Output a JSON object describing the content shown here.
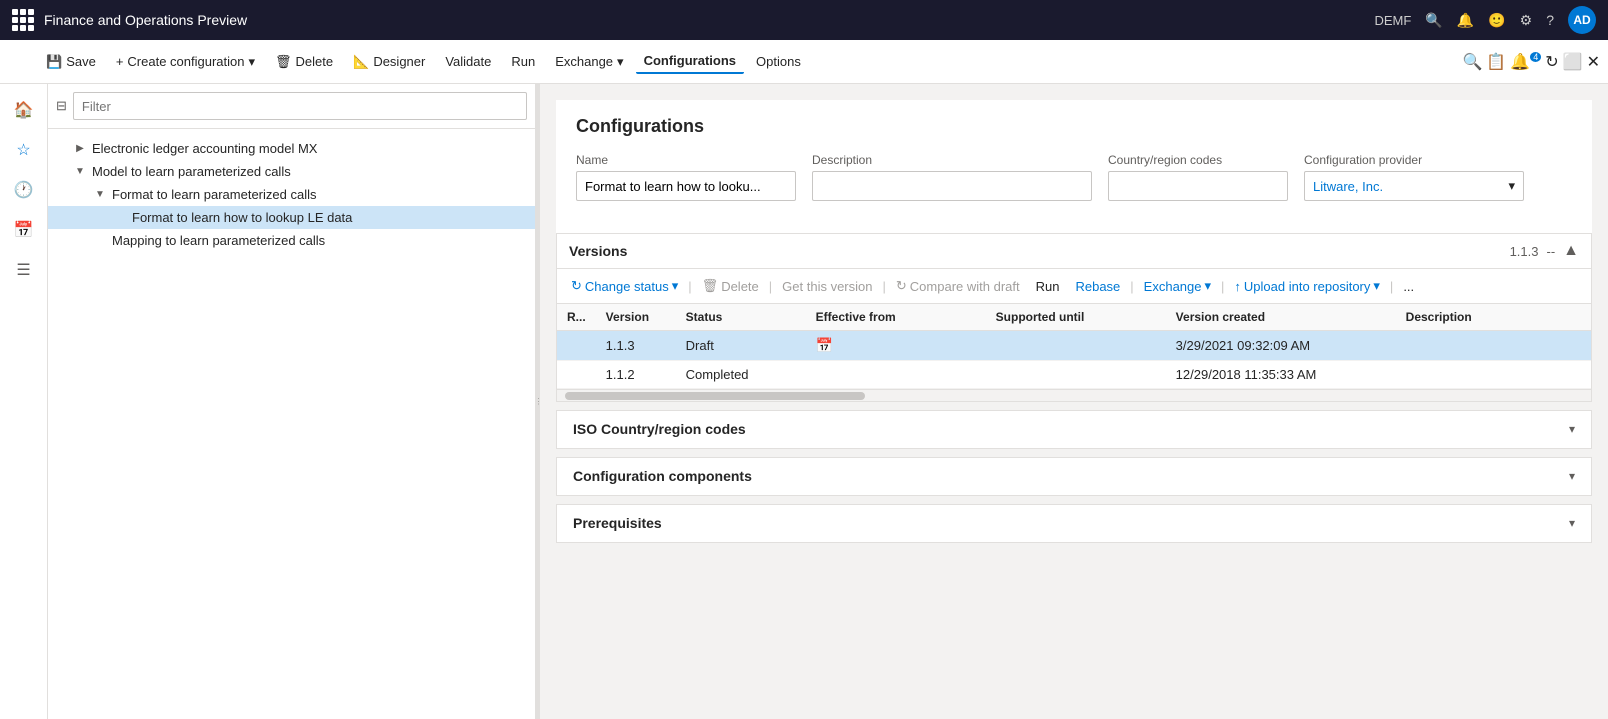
{
  "titleBar": {
    "title": "Finance and Operations Preview",
    "user": "DEMF",
    "avatar": "AD"
  },
  "toolbar": {
    "save": "Save",
    "createConfiguration": "Create configuration",
    "delete": "Delete",
    "designer": "Designer",
    "validate": "Validate",
    "run": "Run",
    "exchange": "Exchange",
    "configurations": "Configurations",
    "options": "Options"
  },
  "filter": {
    "placeholder": "Filter"
  },
  "tree": {
    "items": [
      {
        "label": "Electronic ledger accounting model MX",
        "indent": 1,
        "expanded": false,
        "selected": false
      },
      {
        "label": "Model to learn parameterized calls",
        "indent": 1,
        "expanded": true,
        "selected": false
      },
      {
        "label": "Format to learn parameterized calls",
        "indent": 2,
        "expanded": true,
        "selected": false
      },
      {
        "label": "Format to learn how to lookup LE data",
        "indent": 3,
        "expanded": false,
        "selected": true
      },
      {
        "label": "Mapping to learn parameterized calls",
        "indent": 2,
        "expanded": false,
        "selected": false
      }
    ]
  },
  "configPanel": {
    "title": "Configurations",
    "fields": {
      "nameLabel": "Name",
      "nameValue": "Format to learn how to looku...",
      "descLabel": "Description",
      "descValue": "",
      "countryLabel": "Country/region codes",
      "countryValue": "",
      "providerLabel": "Configuration provider",
      "providerValue": "Litware, Inc."
    }
  },
  "versions": {
    "title": "Versions",
    "currentVersion": "1.1.3",
    "separator": "--",
    "toolbar": {
      "changeStatus": "Change status",
      "delete": "Delete",
      "getThisVersion": "Get this version",
      "compareWithDraft": "Compare with draft",
      "run": "Run",
      "rebase": "Rebase",
      "exchange": "Exchange",
      "uploadIntoRepository": "Upload into repository",
      "more": "..."
    },
    "columns": {
      "r": "R...",
      "version": "Version",
      "status": "Status",
      "effectiveFrom": "Effective from",
      "supportedUntil": "Supported until",
      "versionCreated": "Version created",
      "description": "Description"
    },
    "rows": [
      {
        "r": "",
        "version": "1.1.3",
        "status": "Draft",
        "effectiveFrom": "",
        "supportedUntil": "",
        "versionCreated": "3/29/2021 09:32:09 AM",
        "description": "",
        "selected": true
      },
      {
        "r": "",
        "version": "1.1.2",
        "status": "Completed",
        "effectiveFrom": "",
        "supportedUntil": "",
        "versionCreated": "12/29/2018 11:35:33 AM",
        "description": "",
        "selected": false
      }
    ]
  },
  "sections": {
    "isoCountry": "ISO Country/region codes",
    "configComponents": "Configuration components",
    "prerequisites": "Prerequisites"
  },
  "icons": {
    "apps": "apps-icon",
    "search": "🔍",
    "bell": "🔔",
    "smiley": "🙂",
    "gear": "⚙",
    "help": "?",
    "hamburger": "☰",
    "save": "💾",
    "plus": "+",
    "delete": "🗑",
    "designer": "📐",
    "refresh": "↻",
    "chevronDown": "▾",
    "chevronUp": "▴",
    "calendar": "📅",
    "upload": "↑",
    "compare": "⇌",
    "close": "✕",
    "restore": "⬜",
    "minimize": "—",
    "filter": "⊟"
  }
}
